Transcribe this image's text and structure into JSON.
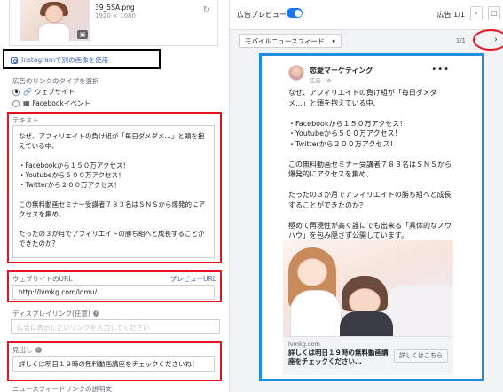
{
  "asset": {
    "filename": "39_5SA.png",
    "dimensions": "1920 × 1080"
  },
  "instagram": {
    "label": "Instagramで別の画像を使用"
  },
  "link_type": {
    "title": "広告のリンクのタイプを選択",
    "options": [
      {
        "label": "ウェブサイト",
        "selected": true
      },
      {
        "label": "Facebookイベント",
        "selected": false
      }
    ]
  },
  "text_field": {
    "label": "テキスト",
    "value": "なぜ、アフィリエイトの負け組が「毎日ダメダメ…」と頭を抱えている中、\n\n・Facebookから１５０万アクセス！\n・Youtubeから５００万アクセス！\n・Twitterから２００万アクセス！\n\nこの無料動画セミナー受講者７８３名はＳＮＳから爆発的にアクセスを集め、\n\nたったの３か月でアフィリエイトの勝ち組へと成長することができたのか？\n\n極めて再現性が高く誰にでも出来る「具体的なノウハウ」を包み隠さず公開しています。"
  },
  "url_field": {
    "label": "ウェブサイトのURL",
    "preview_link": "プレビューURL",
    "value": "http://lvmkg.com/lomu/"
  },
  "display_link": {
    "label": "ディスプレイリンク(任意)",
    "placeholder": "広告に表示したいリンクを入力してください"
  },
  "headline": {
    "label": "見出し",
    "value": "詳しくは明日１９時の無料動画講座をチェックくださいね！"
  },
  "newsfeed_label": "ニュースフィードリンクの説明文",
  "preview": {
    "label": "広告プレビュー",
    "toggle_on": true,
    "ad_count": "広告 1/1",
    "placement": "モバイルニュースフィード",
    "page_count": "1/1",
    "page_name": "恋愛マーケティング",
    "page_sub": "広告 · ",
    "post_text": "なぜ、アフィリエイトの負け組が「毎日ダメダメ…」と頭を抱えている中、\n\n・Facebookから１５０万アクセス！\n・Youtubeから５００万アクセス！\n・Twitterから２００万アクセス！\n\nこの無料動画セミナー受講者７８３名はＳＮＳから爆発的にアクセスを集め、\n\nたったの３か月でアフィリエイトの勝ち組へと成長することができたのか？\n\n極めて再現性が高く誰にでも出来る「具体的なノウハウ」を包み隠さず公開しています。",
    "link_domain": "lvmkg.com",
    "link_headline": "詳しくは明日１９時の無料動画講座をチェックください…",
    "cta_label": "詳しくはこちら"
  },
  "colors": {
    "highlight_red": "#e5141e",
    "highlight_blue": "#1d8fe1",
    "highlight_black": "#000000",
    "fb_blue": "#4267b2",
    "toggle_blue": "#1877f2"
  },
  "icons": [
    "refresh-icon",
    "layers-icon",
    "instagram-icon",
    "link-icon",
    "event-icon",
    "info-icon",
    "toggle-switch",
    "chevron-down-icon",
    "chevron-left-icon",
    "chevron-right-icon",
    "more-icon",
    "globe-icon"
  ]
}
